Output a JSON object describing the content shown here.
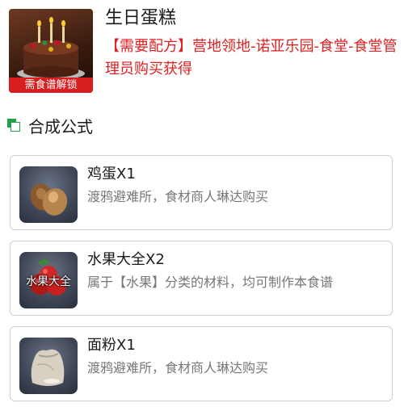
{
  "item": {
    "title": "生日蛋糕",
    "badge": "需食谱解锁",
    "recipe_source": "【需要配方】营地领地-诺亚乐园-食堂-食堂管理员购买获得",
    "image_icon": "cake-icon"
  },
  "section": {
    "title": "合成公式",
    "icon": "formula-icon",
    "accent_color": "#22a04a"
  },
  "ingredients": [
    {
      "name": "鸡蛋X1",
      "desc": "渡鸦避难所，食材商人琳达购买",
      "icon": "egg-icon"
    },
    {
      "name": "水果大全X2",
      "desc": "属于【水果】分类的材料，均可制作本食谱",
      "icon": "fruit-icon",
      "image_label": "水果大全"
    },
    {
      "name": "面粉X1",
      "desc": "渡鸦避难所，食材商人琳达购买",
      "icon": "flour-sack-icon"
    }
  ],
  "colors": {
    "recipe_source_text": "#e02020",
    "badge_background": "#d81e1e",
    "description_text": "#777777",
    "card_border": "#cfcfcf"
  }
}
